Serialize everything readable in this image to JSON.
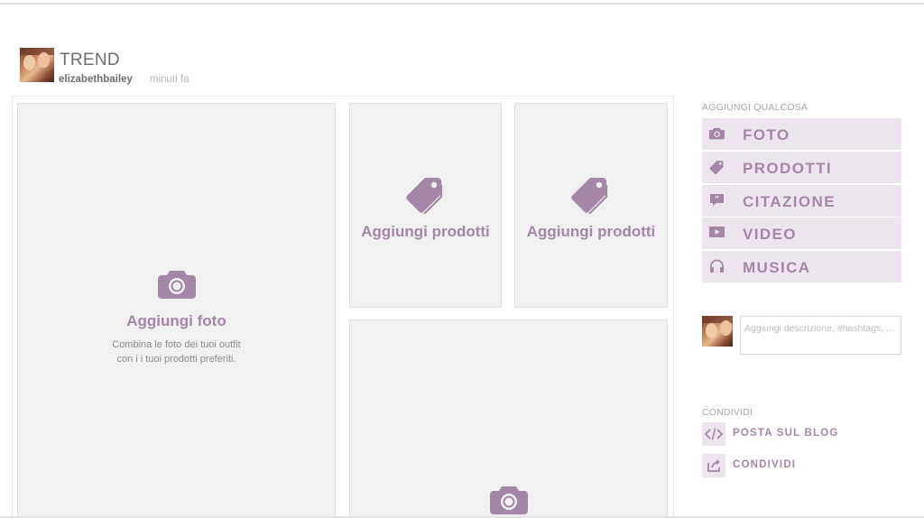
{
  "header": {
    "title": "TREND",
    "username": "elizabethbailey",
    "time": "minuti fa"
  },
  "canvas": {
    "main_slot": {
      "label": "Aggiungi foto",
      "description_line1": "Combina le foto dei tuoi outfit",
      "description_line2": "con i i tuoi prodotti preferiti.",
      "icon": "camera-icon"
    },
    "product_slots": [
      {
        "label": "Aggiungi prodotti",
        "icon": "tag-icon"
      },
      {
        "label": "Aggiungi prodotti",
        "icon": "tag-icon"
      }
    ],
    "bottom_slot": {
      "icon": "camera-icon"
    }
  },
  "sidebar": {
    "add_heading": "AGGIUNGI QUALCOSA",
    "add_items": [
      {
        "label": "FOTO",
        "icon": "camera-icon"
      },
      {
        "label": "PRODOTTI",
        "icon": "tag-icon"
      },
      {
        "label": "CITAZIONE",
        "icon": "quote-icon"
      },
      {
        "label": "VIDEO",
        "icon": "play-icon"
      },
      {
        "label": "MUSICA",
        "icon": "headphones-icon"
      }
    ],
    "description_placeholder": "Aggiungi descrizione, #hashtags, ...",
    "share_heading": "CONDIVIDI",
    "share_items": [
      {
        "label": "POSTA SUL BLOG",
        "icon": "code-icon"
      },
      {
        "label": "CONDIVIDI",
        "icon": "share-icon"
      }
    ]
  },
  "colors": {
    "accent": "#a486a7",
    "accent_light": "#ede5ee",
    "slot_bg": "#f1f1f1"
  }
}
